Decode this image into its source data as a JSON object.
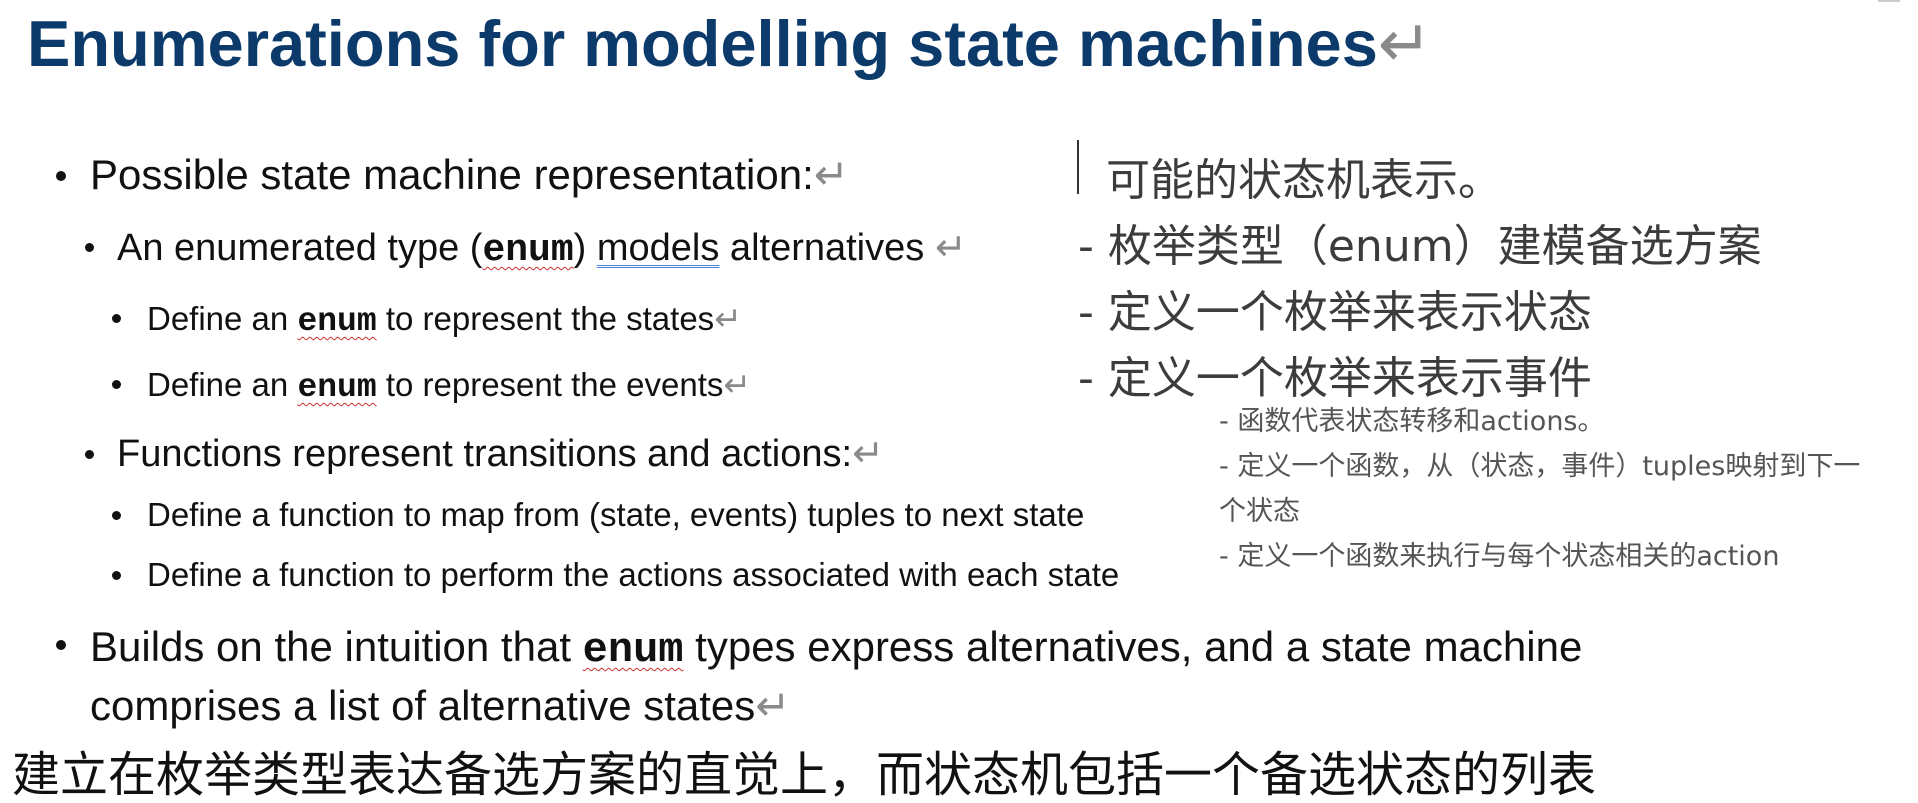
{
  "title": "Enumerations for modelling state machines",
  "return_glyph": "↵",
  "bullets": {
    "b1": {
      "text": "Possible state machine representation:"
    },
    "b1_1": {
      "pre": "An enumerated type (",
      "code": "enum",
      "mid": ") ",
      "underlined": "models",
      "post": " alternatives "
    },
    "b1_1_1": {
      "pre": "Define an ",
      "code": "enum",
      "post": " to represent the states"
    },
    "b1_1_2": {
      "pre": "Define an ",
      "code": "enum",
      "post": " to represent the events"
    },
    "b1_2": {
      "text": "Functions represent transitions and actions:"
    },
    "b1_2_1": {
      "text": "Define a function to map from (state, events) tuples to next state"
    },
    "b1_2_2": {
      "text": "Define a function to perform the actions associated with each state"
    },
    "b2": {
      "pre": "Builds on the intuition that ",
      "code": "enum",
      "post": " types express alternatives, and a state machine",
      "line2": "comprises a list of alternative states"
    }
  },
  "annotations": {
    "big": [
      "可能的状态机表示。",
      "- 枚举类型（enum）建模备选方案",
      "- 定义一个枚举来表示状态",
      "- 定义一个枚举来表示事件"
    ],
    "small": [
      "- 函数代表状态转移和actions。",
      "- 定义一个函数，从（状态，事件）tuples映射到下一",
      "个状态",
      "- 定义一个函数来执行与每个状态相关的action"
    ]
  },
  "footer_zh": "建立在枚举类型表达备选方案的直觉上，而状态机包括一个备选状态的列表",
  "colors": {
    "title": "#0b3a6b",
    "spellcheck": "#d0312d",
    "grammar": "#4a7fd4"
  }
}
